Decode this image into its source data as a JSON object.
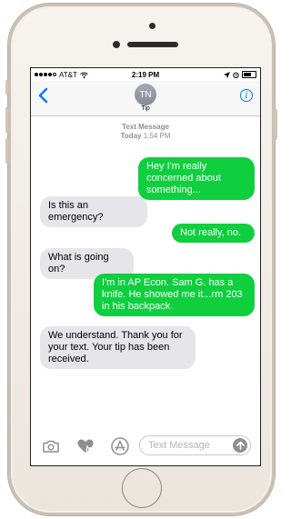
{
  "status": {
    "carrier": "AT&T",
    "time": "2:19 PM"
  },
  "header": {
    "avatar_initials": "TN",
    "contact": "Tip"
  },
  "thread": {
    "service": "Text Message",
    "day": "Today",
    "time": "1:54 PM"
  },
  "messages": [
    {
      "from": "me",
      "text": "Hey I'm really concerned about something..."
    },
    {
      "from": "them",
      "text": "Is this an emergency?"
    },
    {
      "from": "me",
      "text": "Not really, no."
    },
    {
      "from": "them",
      "text": "What is going on?"
    },
    {
      "from": "me",
      "text": "I'm in AP Econ. Sam G. has a knife. He showed me it...rm 203 in his backpack."
    },
    {
      "from": "them",
      "text": "We understand. Thank you for your text. Your tip has been received."
    }
  ],
  "compose": {
    "placeholder": "Text Message"
  },
  "colors": {
    "outgoing": "#0fcf3e",
    "incoming": "#e5e5ea",
    "accent": "#007aff"
  },
  "icons": [
    "back-chevron-icon",
    "info-icon",
    "camera-icon",
    "heart-touch-icon",
    "app-store-icon",
    "send-arrow-icon"
  ]
}
